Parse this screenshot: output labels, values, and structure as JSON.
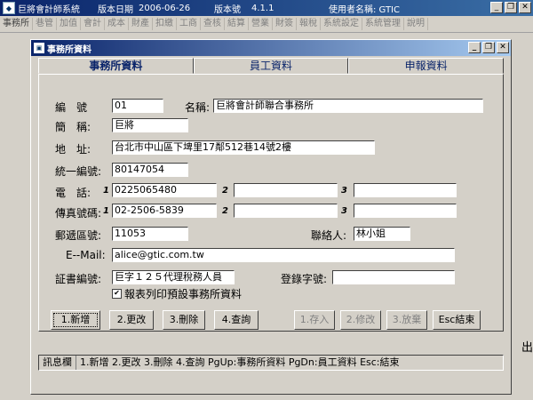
{
  "app": {
    "title": "巨將會計師系統",
    "date_label": "版本日期",
    "date": "2006-06-26",
    "version_label": "版本號",
    "version": "4.1.1",
    "user": "使用者名稱: GTIC",
    "minimize": "_",
    "restore": "❐",
    "close": "✕"
  },
  "menu": [
    "事務所",
    "巷管",
    "加值",
    "會計",
    "成本",
    "財產",
    "扣繳",
    "工商",
    "查核",
    "結算",
    "營業",
    "財簽",
    "報稅",
    "系統設定",
    "系統管理",
    "說明"
  ],
  "right_fragment": "出",
  "dialog": {
    "title": "事務所資料",
    "tabs": [
      "事務所資料",
      "員工資料",
      "申報資料"
    ],
    "fields": {
      "code_label": "編　號",
      "code": "01",
      "name_label": "名稱:",
      "name": "巨將會計師聯合事務所",
      "short_label": "簡　稱:",
      "short": "巨將",
      "address_label": "地　址:",
      "address": "台北市中山區下埤里17鄰512巷14號2樓",
      "tax_label": "統一編號:",
      "tax_id": "80147054",
      "phone_label": "電　話:",
      "phone1": "0225065480",
      "phone2": "",
      "phone3": "",
      "fax_label": "傳真號碼:",
      "fax1": "02-2506-5839",
      "fax2": "",
      "fax3": "",
      "zip_label": "郵遞區號:",
      "zip": "11053",
      "contact_label": "聯絡人:",
      "contact": "林小姐",
      "email_label": "E--Mail:",
      "email": "alice@gtic.com.tw",
      "cert_label": "証書編號:",
      "cert": "巨字１２５代理稅務人員",
      "reg_label": "登錄字號:",
      "reg": "",
      "print_default": "報表列印預設事務所資料",
      "idx1": "1",
      "idx2": "2",
      "idx3": "3"
    },
    "buttons": {
      "add": "1.新增",
      "edit": "2.更改",
      "delete": "3.刪除",
      "query": "4.查詢",
      "save": "1.存入",
      "modify": "2.修改",
      "discard": "3.放棄",
      "esc": "Esc結束"
    },
    "status": {
      "tag": "訊息欄",
      "message": "1.新增 2.更改 3.刪除 4.查詢 PgUp:事務所資料 PgDn:員工資料 Esc:結束"
    }
  }
}
